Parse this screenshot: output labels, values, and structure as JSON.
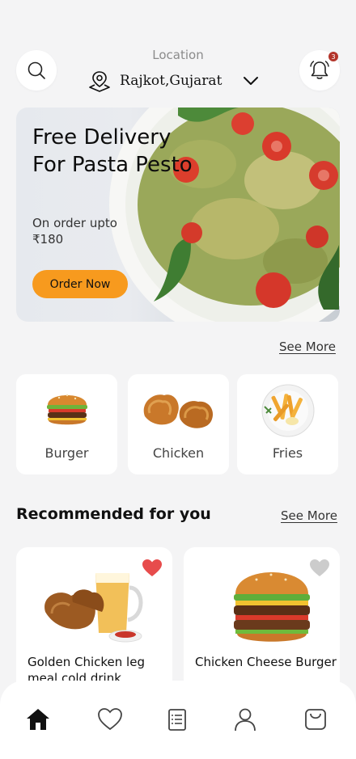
{
  "header": {
    "location_label": "Location",
    "location_value": "Rajkot,Gujarat",
    "notification_count": "3",
    "icons": {
      "search": "search-icon",
      "location": "map-pin-icon",
      "dropdown": "chevron-down-icon",
      "notifications": "bell-icon"
    }
  },
  "banner": {
    "title": "Free Delivery For Pasta Pesto",
    "subtitle": "On order upto ₹180",
    "button_label": "Order Now"
  },
  "categories": {
    "see_more": "See More",
    "items": [
      {
        "label": "Burger"
      },
      {
        "label": "Chicken"
      },
      {
        "label": "Fries"
      }
    ]
  },
  "recommended": {
    "title": "Recommended for you",
    "see_more": "See More",
    "items": [
      {
        "name": "Golden Chicken leg meal cold drink",
        "favorited": true
      },
      {
        "name": "Chicken Cheese Burger",
        "favorited": false
      }
    ]
  },
  "bottom_nav": {
    "items": [
      "home-icon",
      "heart-icon",
      "orders-icon",
      "profile-icon",
      "cart-icon"
    ],
    "active": "home-icon"
  },
  "colors": {
    "accent": "#f79a1e",
    "favorite": "#e74c4c",
    "background": "#f4f4f5"
  }
}
